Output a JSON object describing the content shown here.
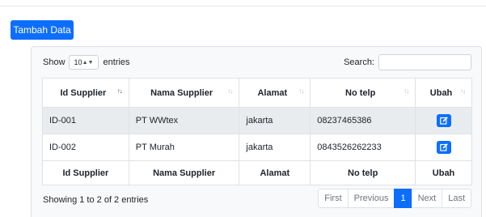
{
  "add_button": {
    "label": "Tambah Data"
  },
  "length_control": {
    "prefix": "Show",
    "value": "10",
    "suffix": "entries"
  },
  "search": {
    "label": "Search:",
    "value": ""
  },
  "table": {
    "columns": [
      "Id Supplier",
      "Nama Supplier",
      "Alamat",
      "No telp",
      "Ubah"
    ],
    "rows": [
      [
        "ID-001",
        "PT WWtex",
        "jakarta",
        "08237465386"
      ],
      [
        "ID-002",
        "PT Murah",
        "jakarta",
        "0843526262233"
      ]
    ],
    "footer": [
      "Id Supplier",
      "Nama Supplier",
      "Alamat",
      "No telp",
      "Ubah"
    ]
  },
  "info": "Showing 1 to 2 of 2 entries",
  "pagination": {
    "first": "First",
    "previous": "Previous",
    "current": "1",
    "next": "Next",
    "last": "Last"
  },
  "icons": {
    "sort": "sort-icon",
    "edit": "edit-icon",
    "select_chevron": "chevron-updown-icon"
  },
  "colors": {
    "primary": "#0d6efd",
    "odd_row": "#e9ecef",
    "card_bg": "#f8f9fa"
  }
}
